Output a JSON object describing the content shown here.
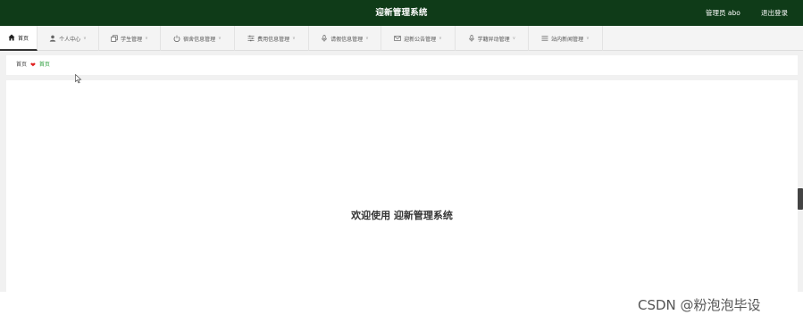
{
  "header": {
    "title": "迎新管理系统",
    "admin_label": "管理员 abo",
    "logout_label": "退出登录"
  },
  "nav": {
    "items": [
      {
        "label": "首页",
        "icon": "home-icon"
      },
      {
        "label": "个人中心",
        "icon": "user-icon"
      },
      {
        "label": "学生管理",
        "icon": "copy-icon"
      },
      {
        "label": "宿舍信息管理",
        "icon": "power-icon"
      },
      {
        "label": "费用信息管理",
        "icon": "sliders-icon"
      },
      {
        "label": "请假信息管理",
        "icon": "microphone-icon"
      },
      {
        "label": "迎新公告管理",
        "icon": "mail-icon"
      },
      {
        "label": "学籍异动管理",
        "icon": "microphone-icon"
      },
      {
        "label": "站内新闻管理",
        "icon": "list-icon"
      }
    ]
  },
  "breadcrumb": {
    "root": "首页",
    "current": "首页"
  },
  "main": {
    "welcome": "欢迎使用 迎新管理系统"
  },
  "watermark": "CSDN @粉泡泡毕设",
  "colors": {
    "header_bg": "#0f3b18",
    "heart": "#e02020",
    "breadcrumb_active": "#2a9d3a"
  }
}
